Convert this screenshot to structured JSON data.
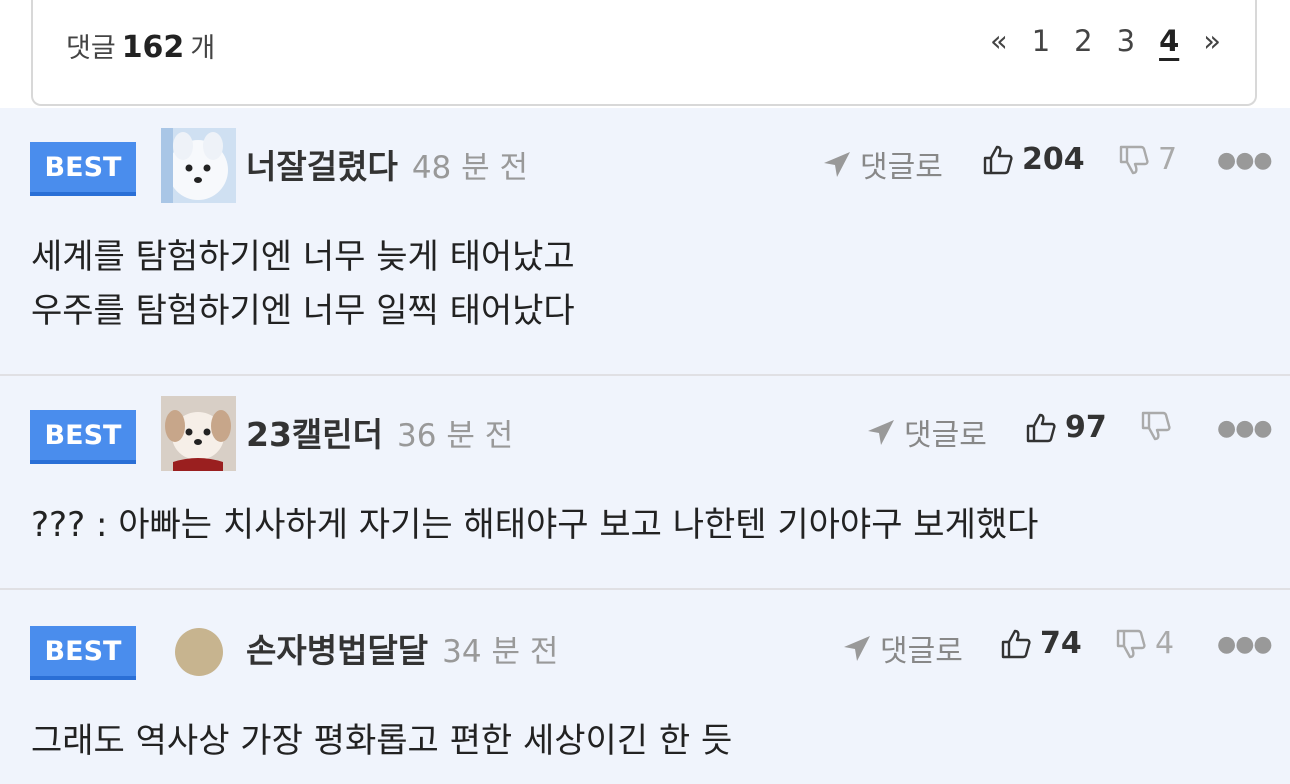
{
  "header": {
    "count_prefix": "댓글",
    "count_value": "162",
    "count_suffix": "개",
    "pager": {
      "first": "«",
      "pages": [
        "1",
        "2",
        "3",
        "4"
      ],
      "current": "4",
      "last": "»"
    }
  },
  "comments": [
    {
      "badge": "BEST",
      "avatar": "white-dog-avatar",
      "nickname": "너잘걸렸다",
      "time": "48 분 전",
      "reply_label": "댓글로",
      "likes": "204",
      "dislikes": "7",
      "lines": [
        "세계를 탐험하기엔 너무 늦게 태어났고",
        "우주를 탐험하기엔 너무 일찍 태어났다"
      ]
    },
    {
      "badge": "BEST",
      "avatar": "puppy-avatar",
      "nickname": "23캘린더",
      "time": "36 분 전",
      "reply_label": "댓글로",
      "likes": "97",
      "dislikes": "",
      "lines": [
        "??? : 아빠는 치사하게 자기는 해태야구 보고 나한텐 기아야구 보게했다"
      ]
    },
    {
      "badge": "BEST",
      "avatar": "default-circle-avatar",
      "nickname": "손자병법달달",
      "time": "34 분 전",
      "reply_label": "댓글로",
      "likes": "74",
      "dislikes": "4",
      "lines": [
        "그래도 역사상 가장 평화롭고 편한 세상이긴 한 듯"
      ]
    }
  ],
  "colors": {
    "badge": "#4a8ded",
    "comment_bg": "#f0f4fc"
  },
  "icons": [
    "reply-arrow-icon",
    "thumbs-up-icon",
    "thumbs-down-icon",
    "more-icon"
  ]
}
